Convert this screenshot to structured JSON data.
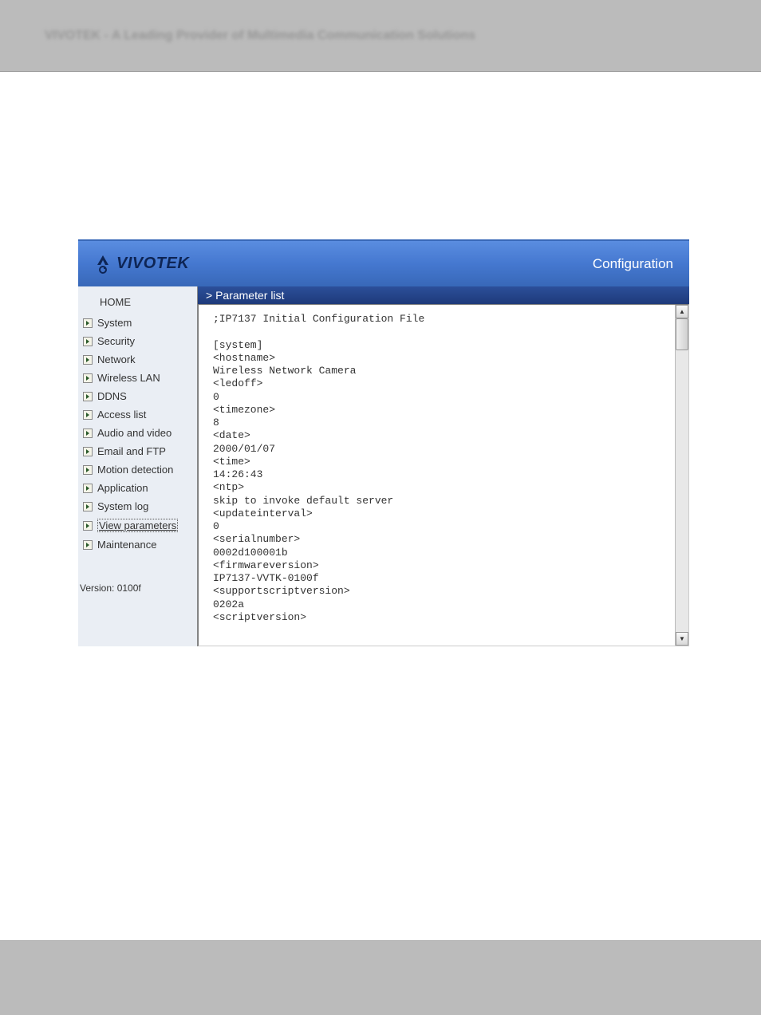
{
  "pageHeader": "VIVOTEK - A Leading Provider of Multimedia Communication Solutions",
  "banner": {
    "logoText": "VIVOTEK",
    "title": "Configuration"
  },
  "sidebar": {
    "home": "HOME",
    "items": [
      {
        "label": "System"
      },
      {
        "label": "Security"
      },
      {
        "label": "Network"
      },
      {
        "label": "Wireless LAN"
      },
      {
        "label": "DDNS"
      },
      {
        "label": "Access list"
      },
      {
        "label": "Audio and video"
      },
      {
        "label": "Email and FTP"
      },
      {
        "label": "Motion detection"
      },
      {
        "label": "Application"
      },
      {
        "label": "System log"
      },
      {
        "label": "View parameters",
        "active": true
      },
      {
        "label": "Maintenance"
      }
    ],
    "version": "Version: 0100f"
  },
  "content": {
    "header": "> Parameter list",
    "body": ";IP7137 Initial Configuration File\n\n[system]\n<hostname>\nWireless Network Camera\n<ledoff>\n0\n<timezone>\n8\n<date>\n2000/01/07\n<time>\n14:26:43\n<ntp>\nskip to invoke default server\n<updateinterval>\n0\n<serialnumber>\n0002d100001b\n<firmwareversion>\nIP7137-VVTK-0100f\n<supportscriptversion>\n0202a\n<scriptversion>"
  }
}
